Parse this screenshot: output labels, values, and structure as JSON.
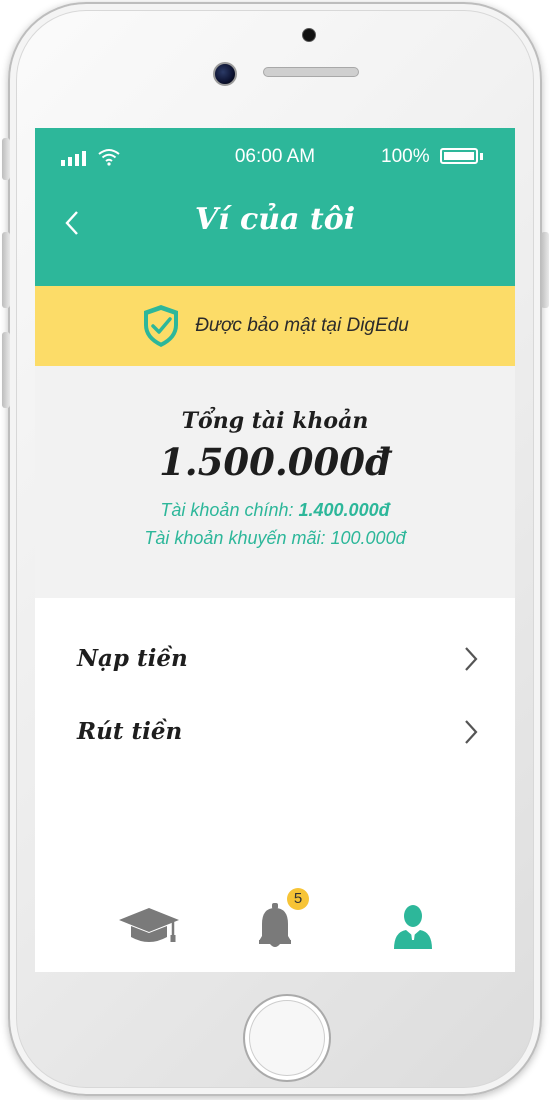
{
  "status_bar": {
    "time": "06:00 AM",
    "battery": "100%"
  },
  "header": {
    "title": "Ví của tôi",
    "back_icon": "chevron-left-icon"
  },
  "security_banner": {
    "text": "Được bảo mật tại DigEdu",
    "icon": "shield-check-icon"
  },
  "balance": {
    "total_label": "Tổng tài khoản",
    "total_value": "1.500.000đ",
    "main_label": "Tài khoản chính:",
    "main_value": "1.400.000đ",
    "promo_label": "Tài khoản khuyến mãi:",
    "promo_value": "100.000đ"
  },
  "menu": {
    "items": [
      {
        "label": "Nạp tiền",
        "icon": "chevron-right-icon"
      },
      {
        "label": "Rút tiền",
        "icon": "chevron-right-icon"
      }
    ]
  },
  "tab_bar": {
    "tabs": [
      {
        "icon": "graduation-cap-icon"
      },
      {
        "icon": "bell-icon",
        "badge": "5"
      },
      {
        "icon": "user-icon",
        "active": true
      }
    ]
  },
  "colors": {
    "primary": "#2db79a",
    "banner": "#fcdc68",
    "panel": "#f2f2f2",
    "badge": "#f7c436"
  }
}
